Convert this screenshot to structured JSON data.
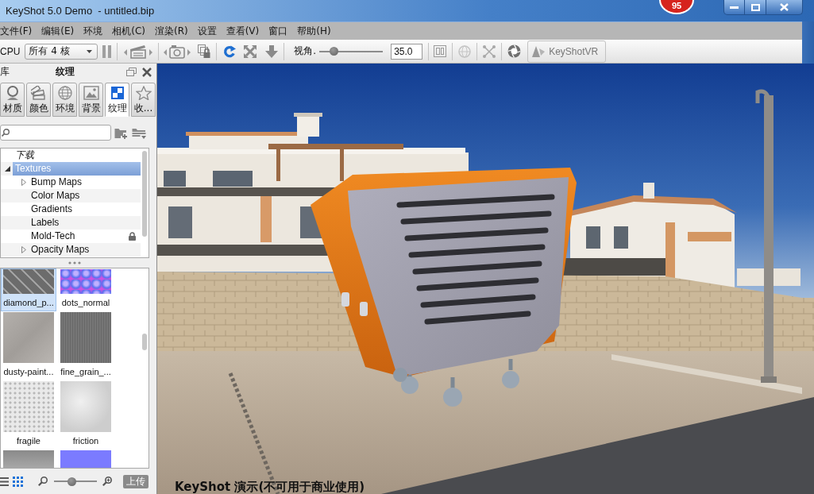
{
  "window": {
    "title": "KeyShot 5.0 Demo  - untitled.bip",
    "badge": "95"
  },
  "menu": [
    "文件(F)",
    "编辑(E)",
    "环境",
    "相机(C)",
    "渲染(R)",
    "设置",
    "查看(V)",
    "窗口",
    "帮助(H)"
  ],
  "toolbar": {
    "cpu_label": "CPU",
    "cpu_select": "所有 4 核",
    "fov_label": "视角.",
    "fov_slider": {
      "level": 0.18
    },
    "fov_value": "35.0",
    "vr_button": "KeyShotVR"
  },
  "library": {
    "side_label": "库",
    "title": "纹理",
    "tabs": [
      {
        "label": "材质",
        "selected": false
      },
      {
        "label": "颜色",
        "selected": false
      },
      {
        "label": "环境",
        "selected": false
      },
      {
        "label": "背景",
        "selected": false
      },
      {
        "label": "纹理",
        "selected": true
      },
      {
        "label": "收...",
        "selected": false
      }
    ],
    "tree": [
      {
        "label": "下载",
        "kind": "shortcut",
        "selected": false,
        "locked": false
      },
      {
        "label": "Textures",
        "kind": "group",
        "expanded": true,
        "selected": true,
        "locked": false,
        "children": [
          {
            "label": "Bump Maps",
            "kind": "group",
            "expanded": false,
            "selected": false,
            "locked": false
          },
          {
            "label": "Color Maps",
            "kind": "leaf",
            "selected": false,
            "locked": false
          },
          {
            "label": "Gradients",
            "kind": "leaf",
            "selected": false,
            "locked": false
          },
          {
            "label": "Labels",
            "kind": "leaf",
            "selected": false,
            "locked": false
          },
          {
            "label": "Mold-Tech",
            "kind": "leaf",
            "selected": false,
            "locked": true
          },
          {
            "label": "Opacity Maps",
            "kind": "group",
            "expanded": false,
            "selected": false,
            "locked": false
          }
        ]
      }
    ],
    "thumbnails": [
      {
        "label": "diamond_p...",
        "kind": "plate",
        "selected": true
      },
      {
        "label": "dots_normal",
        "kind": "normal",
        "selected": false
      },
      {
        "label": "dusty-paint...",
        "kind": "plaster",
        "selected": false
      },
      {
        "label": "fine_grain_...",
        "kind": "grain",
        "selected": false
      },
      {
        "label": "fragile",
        "kind": "speckle",
        "selected": false
      },
      {
        "label": "friction",
        "kind": "mottled",
        "selected": false
      },
      {
        "kind": "stone",
        "selected": false
      },
      {
        "kind": "flat",
        "selected": false
      }
    ],
    "view_modes": [
      {
        "kind": "list",
        "selected": false
      },
      {
        "kind": "grid",
        "selected": true
      }
    ],
    "size_slider": {
      "level": 0.4
    },
    "upload_button": "上传"
  },
  "viewport": {
    "demo_notice": "KeyShot 演示(不可用于商业使用)"
  }
}
